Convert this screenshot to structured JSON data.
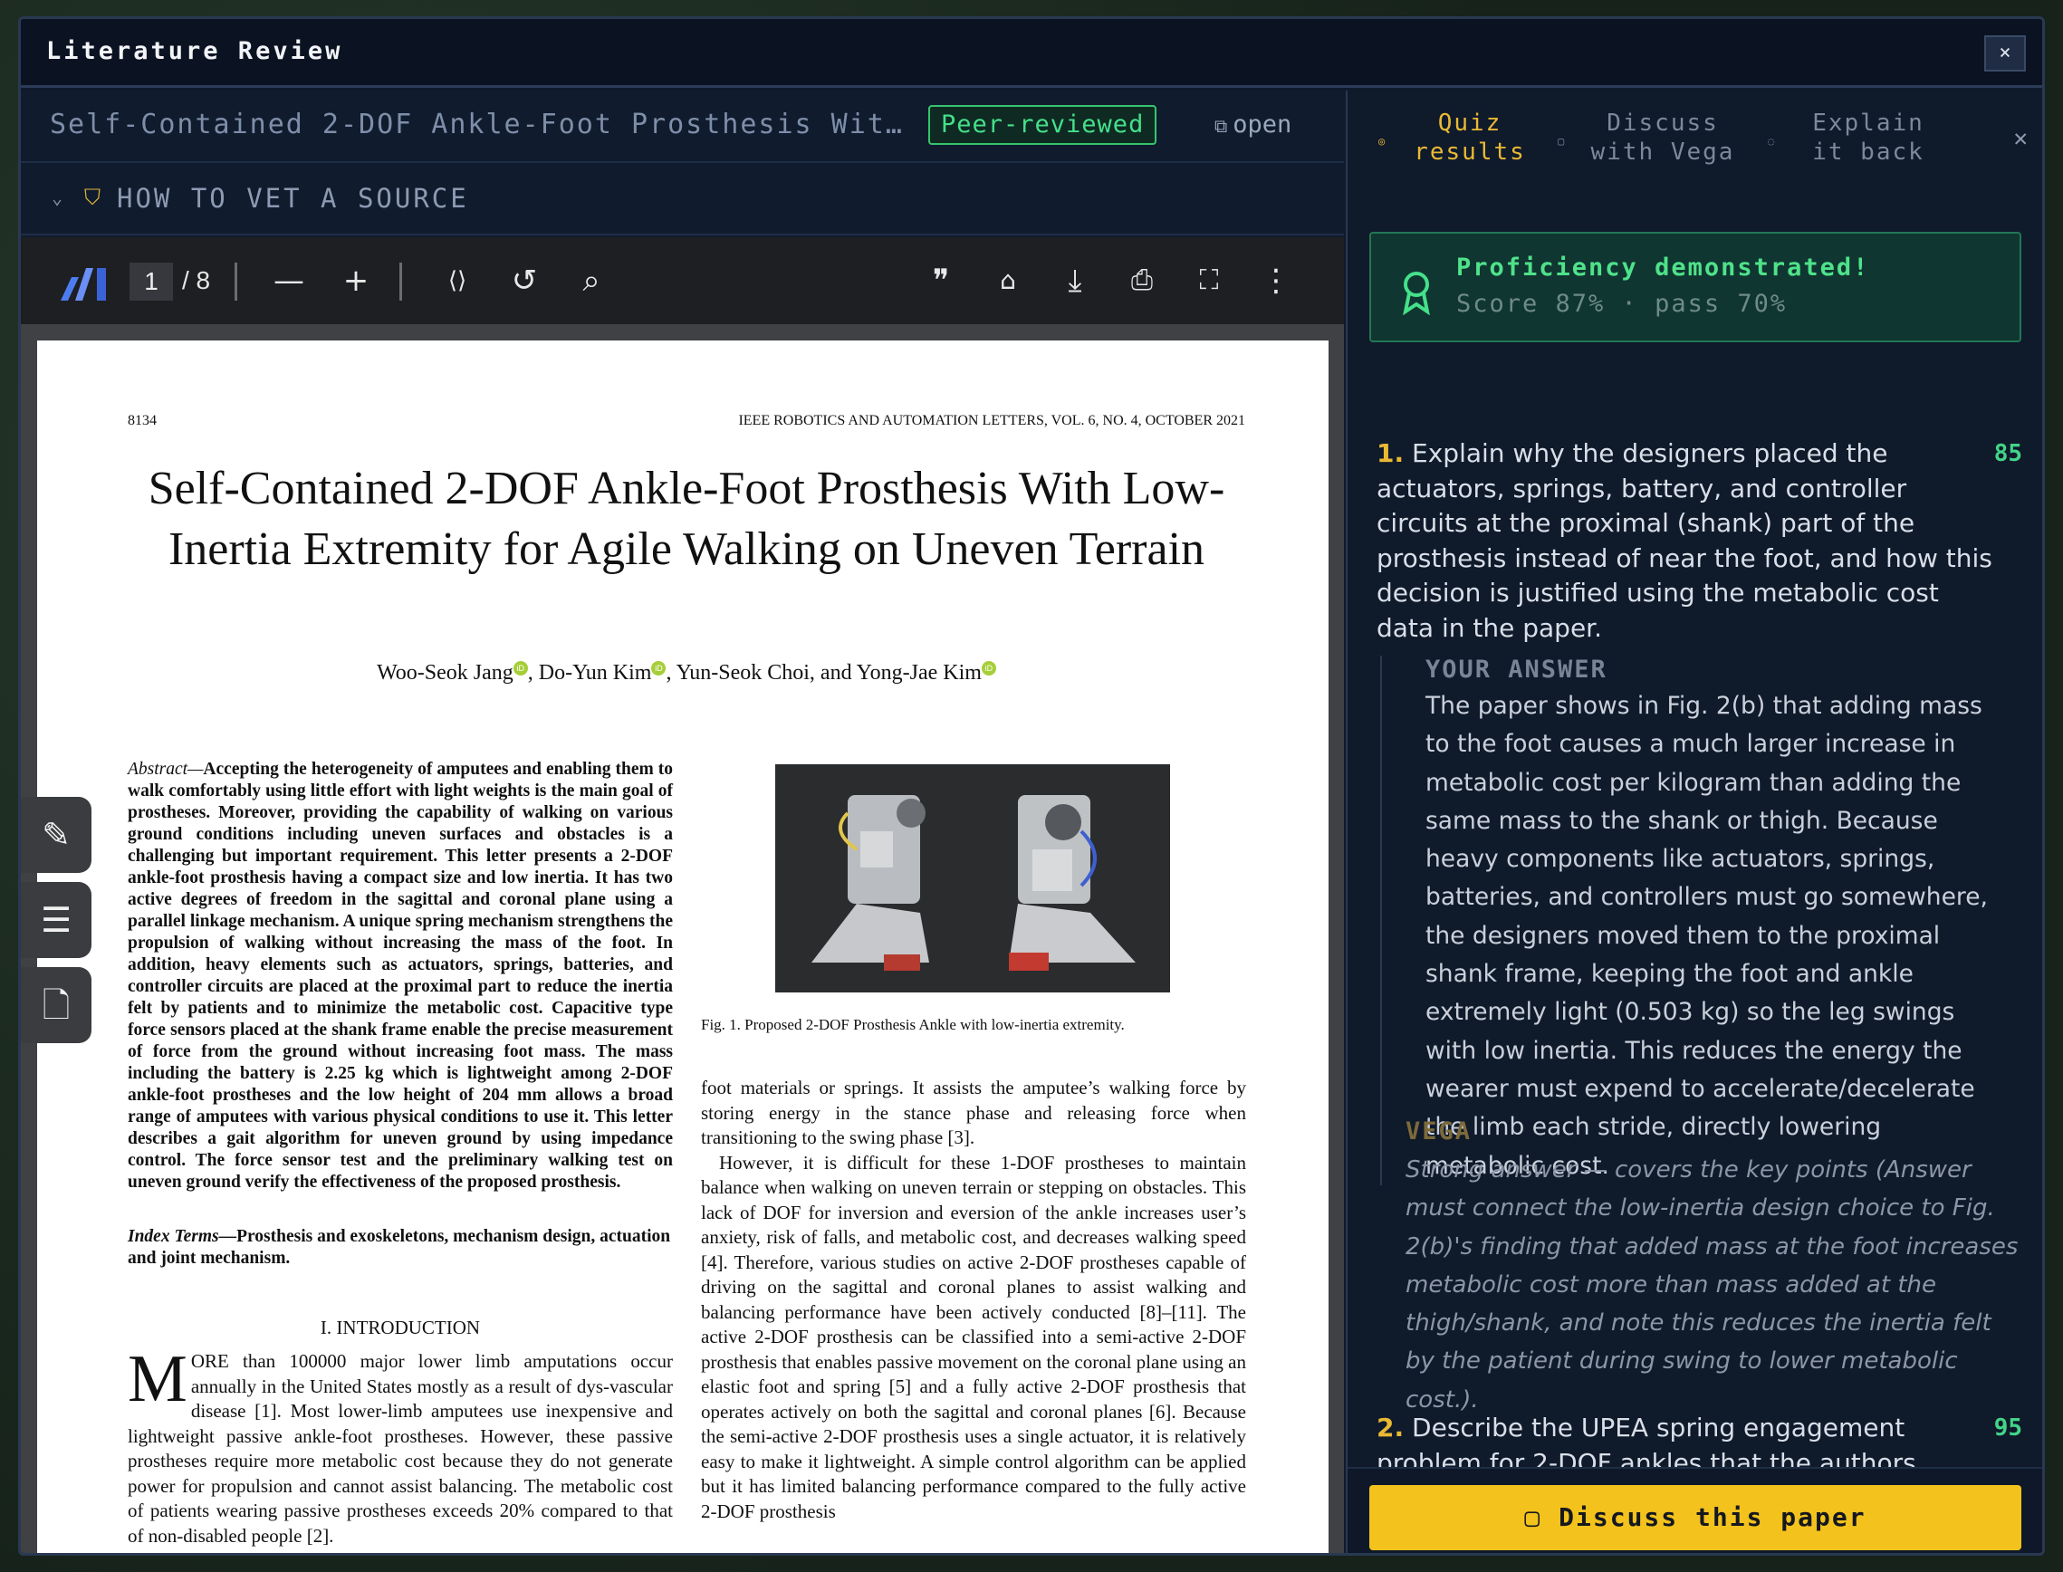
{
  "window": {
    "title": "Literature Review",
    "close_label": "×"
  },
  "doc": {
    "title": "Self-Contained 2-DOF Ankle-Foot Prosthesis Wit…",
    "badge": "Peer-reviewed",
    "open_label": "open",
    "vet_label": "HOW TO VET A SOURCE"
  },
  "pdf_toolbar": {
    "page_current": "1",
    "page_total": "/ 8"
  },
  "paper": {
    "page_number": "8134",
    "journal": "IEEE ROBOTICS AND AUTOMATION LETTERS, VOL. 6, NO. 4, OCTOBER 2021",
    "title": "Self-Contained 2-DOF Ankle-Foot Prosthesis With Low-Inertia Extremity for Agile Walking on Uneven Terrain",
    "authors": [
      "Woo-Seok Jang",
      ", Do-Yun Kim",
      ", Yun-Seok Choi, and Yong-Jae Kim"
    ],
    "abstract_label": "Abstract—",
    "abstract": "Accepting the heterogeneity of amputees and enabling them to walk comfortably using little effort with light weights is the main goal of prostheses. Moreover, providing the capability of walking on various ground conditions including uneven surfaces and obstacles is a challenging but important requirement. This letter presents a 2-DOF ankle-foot prosthesis having a compact size and low inertia. It has two active degrees of freedom in the sagittal and coronal plane using a parallel linkage mechanism. A unique spring mechanism strengthens the propulsion of walking without increasing the mass of the foot. In addition, heavy elements such as actuators, springs, batteries, and controller circuits are placed at the proximal part to reduce the inertia felt by patients and to minimize the metabolic cost. Capacitive type force sensors placed at the shank frame enable the precise measurement of force from the ground without increasing foot mass. The mass including the battery is 2.25 kg which is lightweight among 2-DOF ankle-foot prostheses and the low height of 204 mm allows a broad range of amputees with various physical conditions to use it. This letter describes a gait algorithm for uneven ground by using impedance control. The force sensor test and the preliminary walking test on uneven ground verify the effectiveness of the proposed prosthesis.",
    "index_label": "Index Terms—",
    "index_terms": "Prosthesis and exoskeletons, mechanism design, actuation and joint mechanism.",
    "section_heading": "I. INTRODUCTION",
    "dropcap": "M",
    "intro": "ORE than 100000 major lower limb amputations occur annually in the United States mostly as a result of dys-vascular disease [1]. Most lower-limb amputees use inexpensive and lightweight passive ankle-foot prostheses. However, these passive prostheses require more metabolic cost because they do not generate power for propulsion and cannot assist balancing. The metabolic cost of patients wearing passive prostheses exceeds 20% compared to that of non-disabled people [2].",
    "fig_caption": "Fig. 1.    Proposed 2-DOF Prosthesis Ankle with low-inertia extremity.",
    "right_col_p1": "foot materials or springs. It assists the amputee’s walking force by storing energy in the stance phase and releasing force when transitioning to the swing phase [3].",
    "right_col_p2": "However, it is difficult for these 1-DOF prostheses to maintain balance when walking on uneven terrain or stepping on obstacles. This lack of DOF for inversion and eversion of the ankle increases user’s anxiety, risk of falls, and metabolic cost, and decreases walking speed [4]. Therefore, various studies on active 2-DOF prostheses capable of driving on the sagittal and coronal planes to assist walking and balancing performance have been actively conducted [8]–[11]. The active 2-DOF prosthesis can be classified into a semi-active 2-DOF prosthesis that enables passive movement on the coronal plane using an elastic foot and spring [5] and a fully active 2-DOF prosthesis that operates actively on both the sagittal and coronal planes [6]. Because the semi-active 2-DOF prosthesis uses a single actuator, it is relatively easy to make it lightweight. A simple control algorithm can be applied but it has limited balancing performance compared to the fully active 2-DOF prosthesis"
  },
  "panel": {
    "tabs": [
      {
        "label": "Quiz results",
        "active": true
      },
      {
        "label": "Discuss with Vega",
        "active": false
      },
      {
        "label": "Explain it back",
        "active": false
      }
    ],
    "close_label": "✕",
    "proficiency": {
      "heading": "Proficiency demonstrated!",
      "score_line": "Score 87% · pass 70%"
    },
    "questions": [
      {
        "num": "1.",
        "text": "Explain why the designers placed the actuators, springs, battery, and controller circuits at the proximal (shank) part of the prosthesis instead of near the foot, and how this decision is justified using the metabolic cost data in the paper.",
        "score": "85",
        "answer_label": "YOUR ANSWER",
        "answer": "The paper shows in Fig. 2(b) that adding mass to the foot causes a much larger increase in metabolic cost per kilogram than adding the same mass to the shank or thigh. Because heavy components like actuators, springs, batteries, and controllers must go somewhere, the designers moved them to the proximal shank frame, keeping the foot and ankle extremely light (0.503 kg) so the leg swings with low inertia. This reduces the energy the wearer must expend to accelerate/decelerate the limb each stride, directly lowering metabolic cost.",
        "feedback_label": "VEGA",
        "feedback": "Strong answer — covers the key points (Answer must connect the low-inertia design choice to Fig. 2(b)'s finding that added mass at the foot increases metabolic cost more than mass added at the thigh/shank, and note this reduces the inertia felt by the patient during swing to lower metabolic cost.)."
      },
      {
        "num": "2.",
        "text": "Describe the UPEA spring engagement problem for 2-DOF ankles that the authors identified, and explain how their chosen spring universal-joint placement (equal height h... h)",
        "score": "95"
      }
    ],
    "discuss_button": "Discuss this paper"
  },
  "colors": {
    "accent": "#f3c21d",
    "success": "#45e08a",
    "panel_bg": "#0f1a2b"
  }
}
